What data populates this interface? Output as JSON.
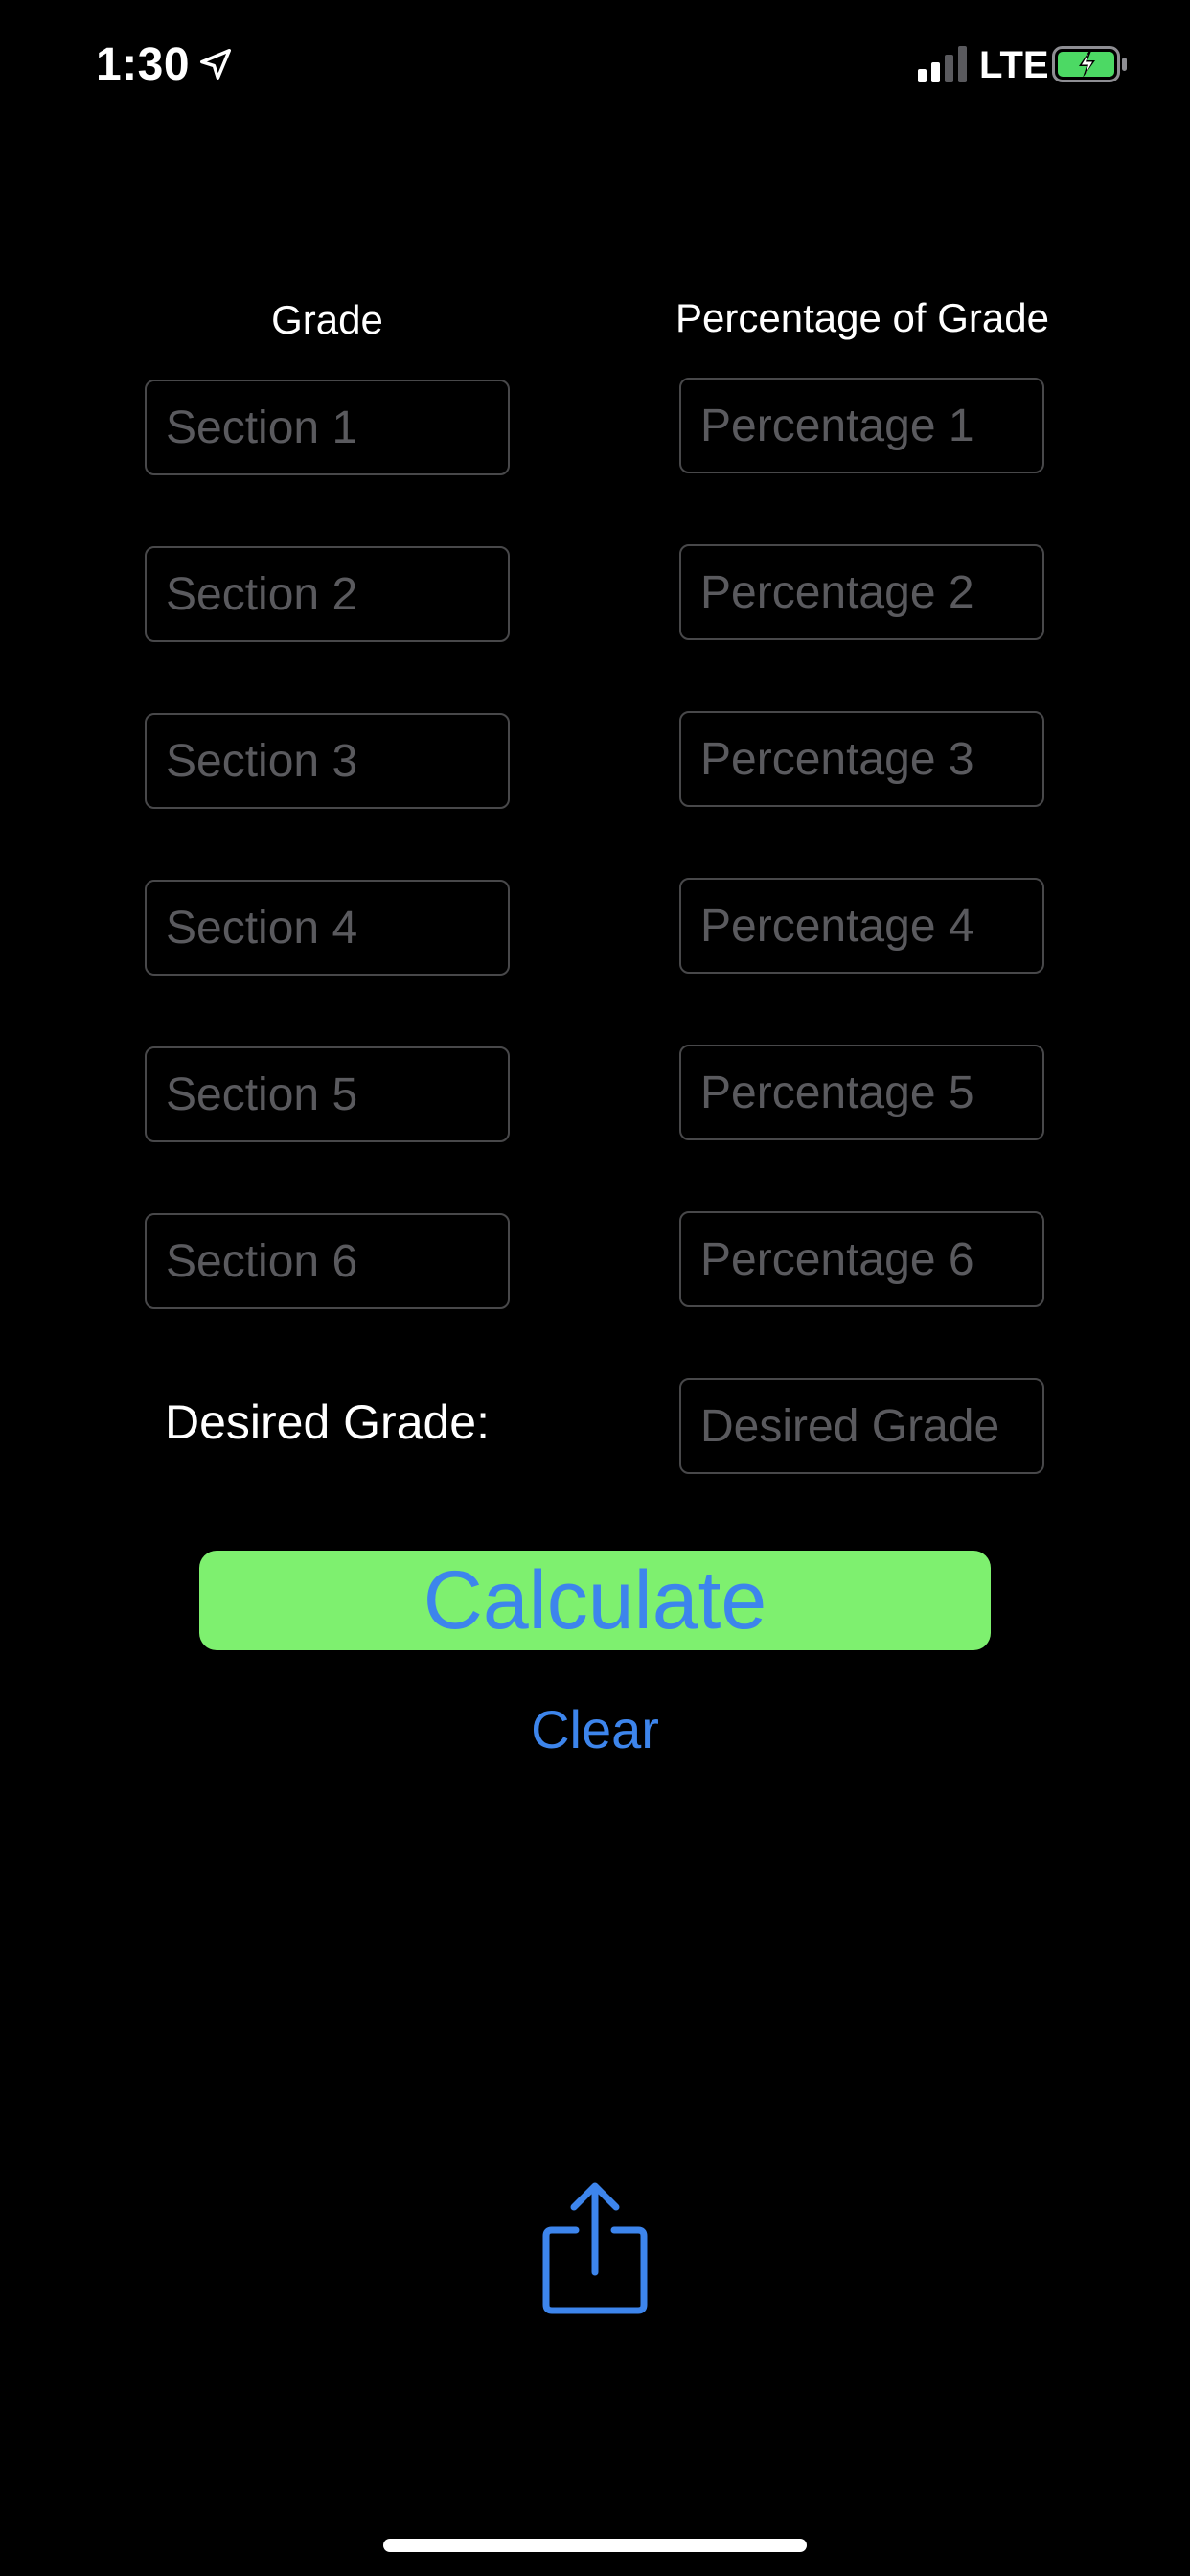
{
  "status_bar": {
    "time": "1:30",
    "network": "LTE",
    "location_icon": "location-arrow-icon",
    "signal_icon": "cellular-signal-icon",
    "battery_icon": "battery-charging-icon",
    "battery_color": "#4cd964"
  },
  "headers": {
    "grade": "Grade",
    "percentage": "Percentage of Grade"
  },
  "sections": [
    {
      "grade_placeholder": "Section 1",
      "grade_value": "",
      "percentage_placeholder": "Percentage 1",
      "percentage_value": ""
    },
    {
      "grade_placeholder": "Section 2",
      "grade_value": "",
      "percentage_placeholder": "Percentage 2",
      "percentage_value": ""
    },
    {
      "grade_placeholder": "Section 3",
      "grade_value": "",
      "percentage_placeholder": "Percentage 3",
      "percentage_value": ""
    },
    {
      "grade_placeholder": "Section 4",
      "grade_value": "",
      "percentage_placeholder": "Percentage 4",
      "percentage_value": ""
    },
    {
      "grade_placeholder": "Section 5",
      "grade_value": "",
      "percentage_placeholder": "Percentage 5",
      "percentage_value": ""
    },
    {
      "grade_placeholder": "Section 6",
      "grade_value": "",
      "percentage_placeholder": "Percentage 6",
      "percentage_value": ""
    }
  ],
  "desired": {
    "label": "Desired Grade:",
    "placeholder": "Desired Grade",
    "value": ""
  },
  "actions": {
    "calculate_label": "Calculate",
    "clear_label": "Clear",
    "share_icon": "share-icon"
  },
  "colors": {
    "background": "#000000",
    "accent": "#3d85ec",
    "calculate_background": "#7ef06f",
    "field_border": "#48484a",
    "placeholder": "#5a5a5e"
  }
}
